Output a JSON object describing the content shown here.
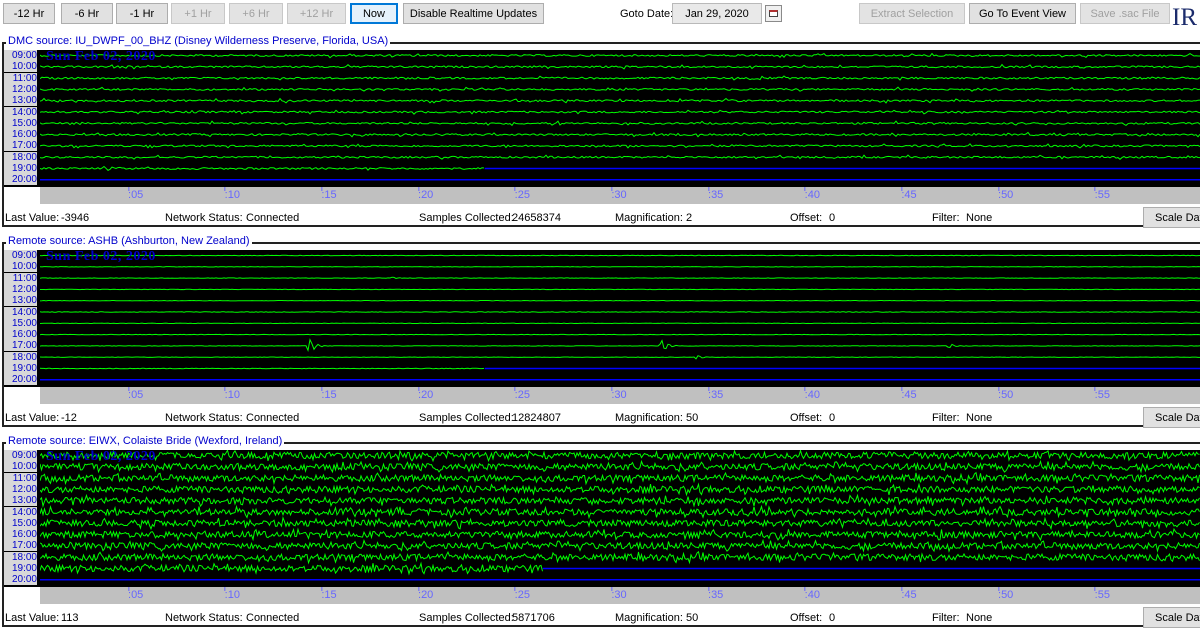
{
  "toolbar": {
    "buttons": [
      {
        "label": "-12 Hr",
        "enabled": true
      },
      {
        "label": "-6 Hr",
        "enabled": true
      },
      {
        "label": "-1 Hr",
        "enabled": true
      },
      {
        "label": "+1 Hr",
        "enabled": false
      },
      {
        "label": "+6 Hr",
        "enabled": false
      },
      {
        "label": "+12 Hr",
        "enabled": false
      },
      {
        "label": "Now",
        "enabled": true
      },
      {
        "label": "Disable Realtime Updates",
        "enabled": true
      }
    ],
    "goto_label": "Goto Date:",
    "goto_value": "Jan 29, 2020",
    "extract_label": "Extract Selection",
    "event_view_label": "Go To Event View",
    "save_sac_label": "Save .sac File",
    "logo_text": "IR"
  },
  "panels": [
    {
      "title": "DMC source: IU_DWPF_00_BHZ (Disney Wilderness Preserve, Florida, USA)",
      "date_overlay": "Sun Feb 02, 2020",
      "last_value_label": "Last Value:",
      "last_value": "-3946",
      "network_label": "Network Status:",
      "network_value": "Connected",
      "samples_label": "Samples Collected:",
      "samples_value": "24658374",
      "magnification_label": "Magnification:",
      "magnification_value": "2",
      "offset_label": "Offset:",
      "offset_value": "0",
      "filter_label": "Filter:",
      "filter_value": "None",
      "scale_label": "Scale Data",
      "trace_style": "moderate",
      "events": []
    },
    {
      "title": "Remote source: ASHB (Ashburton, New Zealand)",
      "date_overlay": "Sun Feb 02, 2020",
      "last_value_label": "Last Value:",
      "last_value": "-12",
      "network_label": "Network Status:",
      "network_value": "Connected",
      "samples_label": "Samples Collected:",
      "samples_value": "12824807",
      "magnification_label": "Magnification:",
      "magnification_value": "50",
      "offset_label": "Offset:",
      "offset_value": "0",
      "filter_label": "Filter:",
      "filter_value": "None",
      "scale_label": "Scale Data",
      "trace_style": "quiet",
      "events": [
        {
          "row": 8,
          "minute": 14.0,
          "amp": 7
        },
        {
          "row": 8,
          "minute": 32.2,
          "amp": 6
        },
        {
          "row": 9,
          "minute": 34.0,
          "amp": 2
        },
        {
          "row": 8,
          "minute": 47.1,
          "amp": 2
        },
        {
          "row": 2,
          "minute": 18.3,
          "amp": 1
        }
      ]
    },
    {
      "title": "Remote source: EIWX, Colaiste Bride (Wexford, Ireland)",
      "date_overlay": "Sun Feb 02, 2020",
      "last_value_label": "Last Value:",
      "last_value": "113",
      "network_label": "Network Status:",
      "network_value": "Connected",
      "samples_label": "Samples Collected:",
      "samples_value": "5871706",
      "magnification_label": "Magnification:",
      "magnification_value": "50",
      "offset_label": "Offset:",
      "offset_value": "0",
      "filter_label": "Filter:",
      "filter_value": "None",
      "scale_label": "Scale Data",
      "trace_style": "noisy",
      "events": []
    }
  ],
  "hour_labels": [
    "09:00",
    "10:00",
    "11:00",
    "12:00",
    "13:00",
    "14:00",
    "15:00",
    "16:00",
    "17:00",
    "18:00",
    "19:00",
    "20:00"
  ],
  "minute_ticks": [
    ":05",
    ":10",
    ":15",
    ":20",
    ":25",
    ":30",
    ":35",
    ":40",
    ":45",
    ":50",
    ":55"
  ],
  "trace_layout": {
    "green_rows": 11,
    "last_row_end_minute": [
      23,
      23,
      26
    ]
  },
  "colors": {
    "trace": "#00ff00",
    "current_line": "#0000ff",
    "hour_label": "#0000cc",
    "tick_label": "#6666ff",
    "plot_bg": "#000000",
    "axis_bg": "#c0c0c0"
  }
}
